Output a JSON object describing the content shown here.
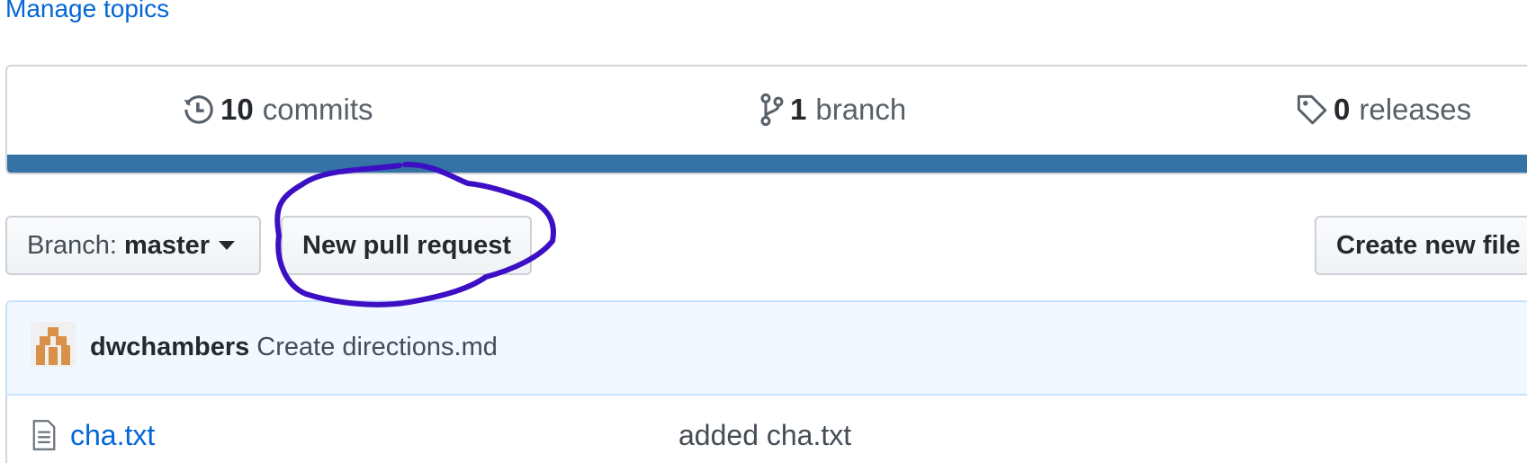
{
  "topics": {
    "manage_label": "Manage topics"
  },
  "summary": {
    "commits": {
      "count": "10",
      "label": "commits",
      "icon": "history-icon"
    },
    "branches": {
      "count": "1",
      "label": "branch",
      "icon": "git-branch-icon"
    },
    "releases": {
      "count": "0",
      "label": "releases",
      "icon": "tag-icon"
    },
    "language_bar_color": "#3572a5"
  },
  "toolbar": {
    "branch_prefix": "Branch:",
    "branch_value": "master",
    "new_pr_label": "New pull request",
    "create_file_label": "Create new file"
  },
  "latest_commit": {
    "author": "dwchambers",
    "message": "Create directions.md"
  },
  "files": [
    {
      "name": "cha.txt",
      "commit_message": "added cha.txt",
      "icon": "file-text-icon"
    }
  ],
  "annotation": {
    "color": "#3d0fc4",
    "target": "New pull request"
  }
}
